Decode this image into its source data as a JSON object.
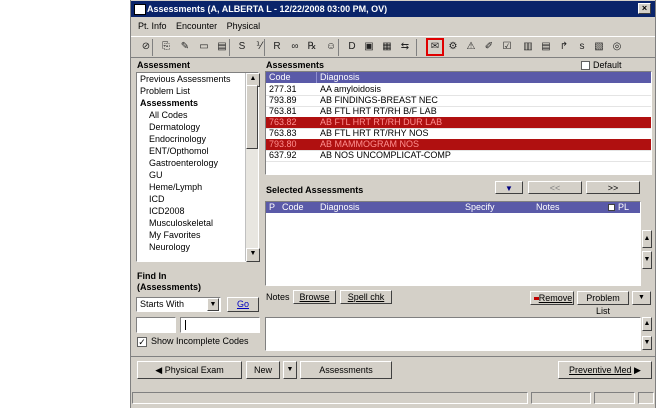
{
  "window": {
    "title": "Assessments (A, ALBERTA L - 12/22/2008 03:00 PM, OV)",
    "close": "×"
  },
  "menu": [
    "Pt. Info",
    "Encounter",
    "Physical"
  ],
  "toolbar": {
    "icons": [
      "stop-icon",
      "copy-icon",
      "edit-icon",
      "note-icon",
      "text-icon",
      "s-icon",
      "ix-icon",
      "r-icon",
      "gear-icon",
      "rx-icon",
      "person-icon",
      "dx-icon",
      "printer-icon",
      "image-icon",
      "transfer-icon",
      "assessments-icon",
      "badge-icon",
      "warning-icon",
      "pencil-icon",
      "chart-icon",
      "table-icon",
      "form-icon",
      "flow-icon",
      "sd-icon",
      "document-icon",
      "refresh-icon"
    ],
    "glyphs": [
      "⊘",
      "⎘",
      "✎",
      "▭",
      "▤",
      "S",
      "⅟",
      "R",
      "∞",
      "℞",
      "☺",
      "D",
      "▣",
      "▦",
      "⇆",
      "✉",
      "⚙",
      "⚠",
      "✐",
      "☑",
      "▥",
      "▤",
      "↱",
      "s",
      "▧",
      "◎"
    ]
  },
  "left": {
    "title": "Assessment",
    "tree": [
      {
        "label": "Previous Assessments",
        "kind": "top"
      },
      {
        "label": "Problem List",
        "kind": "top"
      },
      {
        "label": "Assessments",
        "kind": "b"
      },
      {
        "label": "All Codes",
        "kind": "c"
      },
      {
        "label": "Dermatology",
        "kind": "c"
      },
      {
        "label": "Endocrinology",
        "kind": "c"
      },
      {
        "label": "ENT/Opthomol",
        "kind": "c"
      },
      {
        "label": "Gastroenterology",
        "kind": "c"
      },
      {
        "label": "GU",
        "kind": "c"
      },
      {
        "label": "Heme/Lymph",
        "kind": "c"
      },
      {
        "label": "ICD",
        "kind": "c"
      },
      {
        "label": "ICD2008",
        "kind": "c"
      },
      {
        "label": "Musculoskeletal",
        "kind": "c"
      },
      {
        "label": "My Favorites",
        "kind": "c"
      },
      {
        "label": "Neurology",
        "kind": "c"
      }
    ],
    "find_title": "Find In",
    "find_sub": "(Assessments)",
    "starts_with": "Starts With",
    "go": "Go",
    "input1": "",
    "input2": "",
    "show_incomplete": "Show Incomplete Codes"
  },
  "assessments": {
    "title": "Assessments",
    "default_label": "Default",
    "columns": [
      "Code",
      "Diagnosis"
    ],
    "rows": [
      {
        "code": "277.31",
        "diagnosis": "AA amyloidosis",
        "red": false
      },
      {
        "code": "793.89",
        "diagnosis": "AB FINDINGS-BREAST NEC",
        "red": false
      },
      {
        "code": "763.81",
        "diagnosis": "AB FTL HRT RT/RH B/F LAB",
        "red": false
      },
      {
        "code": "763.82",
        "diagnosis": "AB FTL HRT RT/RH DUR LAB",
        "red": true
      },
      {
        "code": "763.83",
        "diagnosis": "AB FTL HRT RT/RHY NOS",
        "red": false
      },
      {
        "code": "793.80",
        "diagnosis": "AB MAMMOGRAM NOS",
        "red": true
      },
      {
        "code": "637.92",
        "diagnosis": "AB NOS UNCOMPLICAT-COMP",
        "red": false
      }
    ]
  },
  "selected": {
    "title": "Selected Assessments",
    "columns": [
      "P",
      "Code",
      "Diagnosis",
      "Specify",
      "Notes",
      "PL"
    ],
    "prev": "<<",
    "next": ">>"
  },
  "notes": {
    "label": "Notes",
    "browse": "Browse",
    "spell": "Spell chk",
    "remove": "Remove",
    "problem_list": "Problem List"
  },
  "nav": {
    "physical_exam": "Physical Exam",
    "new": "New",
    "assessments": "Assessments",
    "preventive": "Preventive Med"
  }
}
